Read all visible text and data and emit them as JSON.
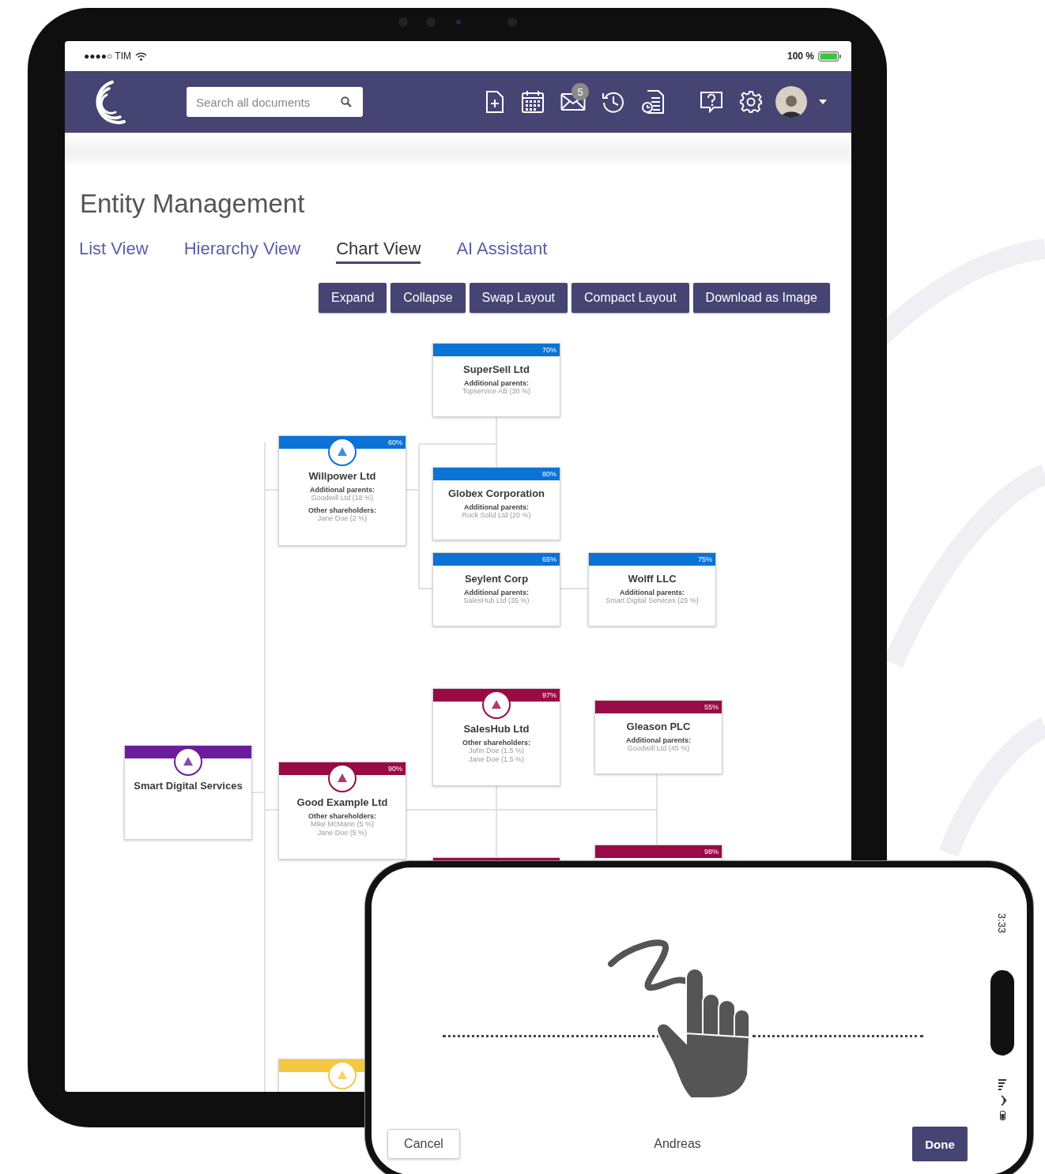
{
  "tablet": {
    "status_bar": {
      "carrier": "●●●●○ TIM",
      "battery": "100 %"
    },
    "navbar": {
      "search": {
        "placeholder": "Search all documents"
      },
      "notification_count": "5"
    },
    "page_title": "Entity Management",
    "tabs": [
      {
        "label": "List View",
        "selected": false
      },
      {
        "label": "Hierarchy View",
        "selected": false
      },
      {
        "label": "Chart View",
        "selected": true
      },
      {
        "label": "AI Assistant",
        "selected": false
      }
    ],
    "buttons": [
      "Expand",
      "Collapse",
      "Swap Layout",
      "Compact Layout",
      "Download as Image"
    ],
    "org_chart": {
      "nodes": [
        {
          "name": "SuperSell Ltd",
          "percent": "70%",
          "color": "#0b72d6",
          "logo": false,
          "sections": [
            {
              "heading": "Additional parents:",
              "lines": [
                "Topservice AB (30 %)"
              ]
            }
          ]
        },
        {
          "name": "Willpower Ltd",
          "percent": "60%",
          "color": "#0b72d6",
          "logo": true,
          "sections": [
            {
              "heading": "Additional parents:",
              "lines": [
                "Goodwill Ltd (18 %)"
              ]
            },
            {
              "heading": "Other shareholders:",
              "lines": [
                "Jane Doe (2 %)"
              ]
            }
          ]
        },
        {
          "name": "Globex Corporation",
          "percent": "80%",
          "color": "#0b72d6",
          "logo": false,
          "sections": [
            {
              "heading": "Additional parents:",
              "lines": [
                "Rock Solid Ltd (20 %)"
              ]
            }
          ]
        },
        {
          "name": "Seylent Corp",
          "percent": "65%",
          "color": "#0b72d6",
          "logo": false,
          "sections": [
            {
              "heading": "Additional parents:",
              "lines": [
                "SalesHub Ltd (35 %)"
              ]
            }
          ]
        },
        {
          "name": "Wolff LLC",
          "percent": "75%",
          "color": "#0b72d6",
          "logo": false,
          "sections": [
            {
              "heading": "Additional parents:",
              "lines": [
                "Smart Digital Services (25 %)"
              ]
            }
          ]
        },
        {
          "name": "SalesHub Ltd",
          "percent": "97%",
          "color": "#9a0a44",
          "logo": true,
          "sections": [
            {
              "heading": "Other shareholders:",
              "lines": [
                "John Doe (1.5 %)",
                "Jane Doe (1.5 %)"
              ]
            }
          ]
        },
        {
          "name": "Gleason PLC",
          "percent": "55%",
          "color": "#9a0a44",
          "logo": false,
          "sections": [
            {
              "heading": "Additional parents:",
              "lines": [
                "Goodwill Ltd (45 %)"
              ]
            }
          ]
        },
        {
          "name": "Smart Digital Services",
          "color": "#6c1d9e",
          "logo": true
        },
        {
          "name": "Good Example Ltd",
          "percent": "90%",
          "color": "#9a0a44",
          "logo": true,
          "sections": [
            {
              "heading": "Other shareholders:",
              "lines": [
                "Mike McMann (5 %)",
                "Jane Doe (5 %)"
              ]
            }
          ]
        },
        {
          "percent": "98%",
          "color": "#9a0a44",
          "logo": false
        },
        {
          "color": "#9a0a44",
          "logo": false
        },
        {
          "color": "#f5c842",
          "logo": true
        }
      ]
    }
  },
  "phone": {
    "status_bar": {
      "time": "3:33"
    },
    "signer": "Andreas",
    "buttons": [
      "Cancel",
      "Done"
    ]
  }
}
